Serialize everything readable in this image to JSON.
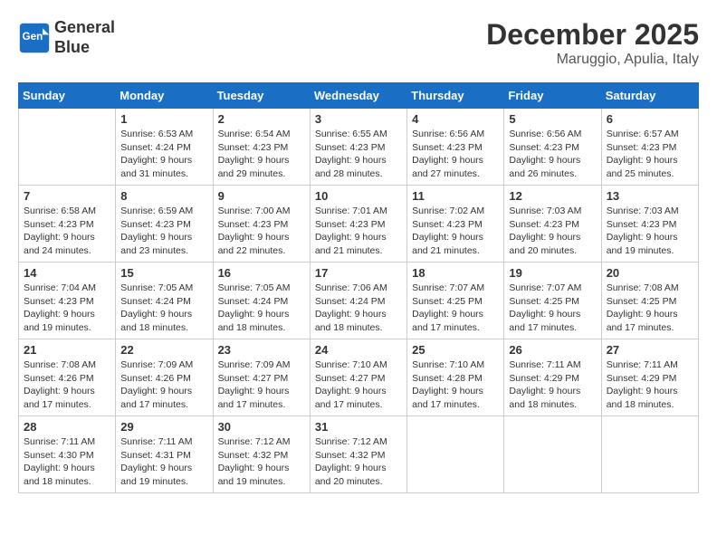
{
  "logo": {
    "line1": "General",
    "line2": "Blue"
  },
  "title": "December 2025",
  "subtitle": "Maruggio, Apulia, Italy",
  "days_of_week": [
    "Sunday",
    "Monday",
    "Tuesday",
    "Wednesday",
    "Thursday",
    "Friday",
    "Saturday"
  ],
  "weeks": [
    [
      {
        "day": "",
        "info": ""
      },
      {
        "day": "1",
        "info": "Sunrise: 6:53 AM\nSunset: 4:24 PM\nDaylight: 9 hours\nand 31 minutes."
      },
      {
        "day": "2",
        "info": "Sunrise: 6:54 AM\nSunset: 4:23 PM\nDaylight: 9 hours\nand 29 minutes."
      },
      {
        "day": "3",
        "info": "Sunrise: 6:55 AM\nSunset: 4:23 PM\nDaylight: 9 hours\nand 28 minutes."
      },
      {
        "day": "4",
        "info": "Sunrise: 6:56 AM\nSunset: 4:23 PM\nDaylight: 9 hours\nand 27 minutes."
      },
      {
        "day": "5",
        "info": "Sunrise: 6:56 AM\nSunset: 4:23 PM\nDaylight: 9 hours\nand 26 minutes."
      },
      {
        "day": "6",
        "info": "Sunrise: 6:57 AM\nSunset: 4:23 PM\nDaylight: 9 hours\nand 25 minutes."
      }
    ],
    [
      {
        "day": "7",
        "info": "Sunrise: 6:58 AM\nSunset: 4:23 PM\nDaylight: 9 hours\nand 24 minutes."
      },
      {
        "day": "8",
        "info": "Sunrise: 6:59 AM\nSunset: 4:23 PM\nDaylight: 9 hours\nand 23 minutes."
      },
      {
        "day": "9",
        "info": "Sunrise: 7:00 AM\nSunset: 4:23 PM\nDaylight: 9 hours\nand 22 minutes."
      },
      {
        "day": "10",
        "info": "Sunrise: 7:01 AM\nSunset: 4:23 PM\nDaylight: 9 hours\nand 21 minutes."
      },
      {
        "day": "11",
        "info": "Sunrise: 7:02 AM\nSunset: 4:23 PM\nDaylight: 9 hours\nand 21 minutes."
      },
      {
        "day": "12",
        "info": "Sunrise: 7:03 AM\nSunset: 4:23 PM\nDaylight: 9 hours\nand 20 minutes."
      },
      {
        "day": "13",
        "info": "Sunrise: 7:03 AM\nSunset: 4:23 PM\nDaylight: 9 hours\nand 19 minutes."
      }
    ],
    [
      {
        "day": "14",
        "info": "Sunrise: 7:04 AM\nSunset: 4:23 PM\nDaylight: 9 hours\nand 19 minutes."
      },
      {
        "day": "15",
        "info": "Sunrise: 7:05 AM\nSunset: 4:24 PM\nDaylight: 9 hours\nand 18 minutes."
      },
      {
        "day": "16",
        "info": "Sunrise: 7:05 AM\nSunset: 4:24 PM\nDaylight: 9 hours\nand 18 minutes."
      },
      {
        "day": "17",
        "info": "Sunrise: 7:06 AM\nSunset: 4:24 PM\nDaylight: 9 hours\nand 18 minutes."
      },
      {
        "day": "18",
        "info": "Sunrise: 7:07 AM\nSunset: 4:25 PM\nDaylight: 9 hours\nand 17 minutes."
      },
      {
        "day": "19",
        "info": "Sunrise: 7:07 AM\nSunset: 4:25 PM\nDaylight: 9 hours\nand 17 minutes."
      },
      {
        "day": "20",
        "info": "Sunrise: 7:08 AM\nSunset: 4:25 PM\nDaylight: 9 hours\nand 17 minutes."
      }
    ],
    [
      {
        "day": "21",
        "info": "Sunrise: 7:08 AM\nSunset: 4:26 PM\nDaylight: 9 hours\nand 17 minutes."
      },
      {
        "day": "22",
        "info": "Sunrise: 7:09 AM\nSunset: 4:26 PM\nDaylight: 9 hours\nand 17 minutes."
      },
      {
        "day": "23",
        "info": "Sunrise: 7:09 AM\nSunset: 4:27 PM\nDaylight: 9 hours\nand 17 minutes."
      },
      {
        "day": "24",
        "info": "Sunrise: 7:10 AM\nSunset: 4:27 PM\nDaylight: 9 hours\nand 17 minutes."
      },
      {
        "day": "25",
        "info": "Sunrise: 7:10 AM\nSunset: 4:28 PM\nDaylight: 9 hours\nand 17 minutes."
      },
      {
        "day": "26",
        "info": "Sunrise: 7:11 AM\nSunset: 4:29 PM\nDaylight: 9 hours\nand 18 minutes."
      },
      {
        "day": "27",
        "info": "Sunrise: 7:11 AM\nSunset: 4:29 PM\nDaylight: 9 hours\nand 18 minutes."
      }
    ],
    [
      {
        "day": "28",
        "info": "Sunrise: 7:11 AM\nSunset: 4:30 PM\nDaylight: 9 hours\nand 18 minutes."
      },
      {
        "day": "29",
        "info": "Sunrise: 7:11 AM\nSunset: 4:31 PM\nDaylight: 9 hours\nand 19 minutes."
      },
      {
        "day": "30",
        "info": "Sunrise: 7:12 AM\nSunset: 4:32 PM\nDaylight: 9 hours\nand 19 minutes."
      },
      {
        "day": "31",
        "info": "Sunrise: 7:12 AM\nSunset: 4:32 PM\nDaylight: 9 hours\nand 20 minutes."
      },
      {
        "day": "",
        "info": ""
      },
      {
        "day": "",
        "info": ""
      },
      {
        "day": "",
        "info": ""
      }
    ]
  ]
}
